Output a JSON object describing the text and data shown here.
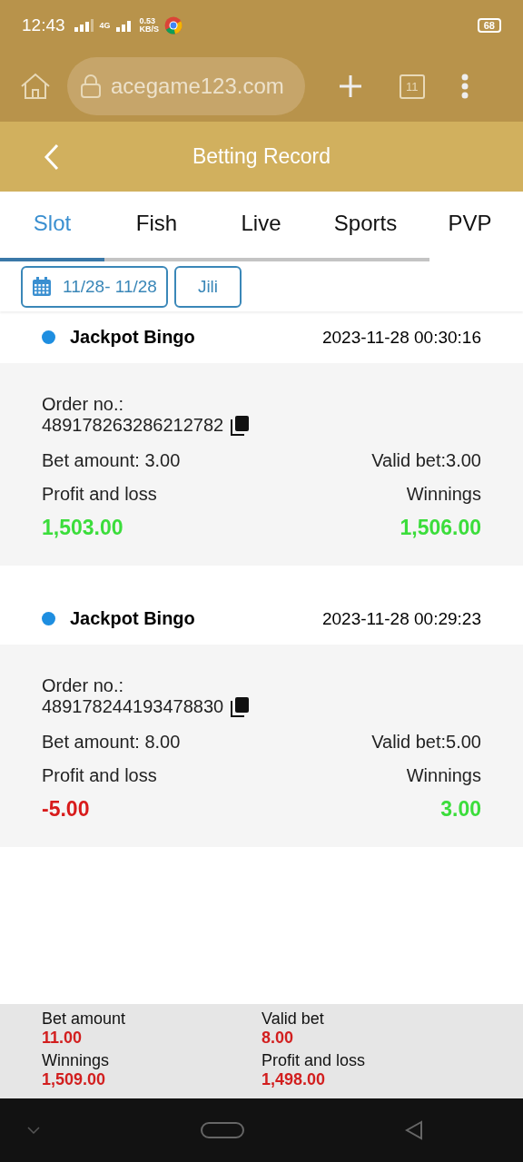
{
  "status_bar": {
    "time": "12:43",
    "network": "4G",
    "speed": "0.53",
    "speed_unit": "KB/S",
    "battery": "68"
  },
  "browser": {
    "url": "acegame123.com",
    "tab_count": "11"
  },
  "header": {
    "title": "Betting Record"
  },
  "tabs": [
    {
      "label": "Slot",
      "selected": true
    },
    {
      "label": "Fish",
      "selected": false
    },
    {
      "label": "Live",
      "selected": false
    },
    {
      "label": "Sports",
      "selected": false
    },
    {
      "label": "PVP",
      "selected": false
    }
  ],
  "filters": {
    "date_range": "11/28- 11/28",
    "provider": "Jili"
  },
  "records": [
    {
      "game": "Jackpot Bingo",
      "time": "2023-11-28 00:30:16",
      "order_label": "Order no.:",
      "order_no": "489178263286212782",
      "bet_amount": "Bet amount: 3.00",
      "valid_bet": "Valid bet:3.00",
      "profit_label": "Profit and loss",
      "profit": {
        "value": "1,503.00",
        "color": "#3bdd3b"
      },
      "winnings_label": "Winnings",
      "winnings": {
        "value": "1,506.00",
        "color": "#3bdd3b"
      }
    },
    {
      "game": "Jackpot Bingo",
      "time": "2023-11-28 00:29:23",
      "order_label": "Order no.:",
      "order_no": "489178244193478830",
      "bet_amount": "Bet amount: 8.00",
      "valid_bet": "Valid bet:5.00",
      "profit_label": "Profit and loss",
      "profit": {
        "value": "-5.00",
        "color": "#d81b1b"
      },
      "winnings_label": "Winnings",
      "winnings": {
        "value": "3.00",
        "color": "#3bdd3b"
      }
    }
  ],
  "summary": [
    {
      "label": "Bet amount",
      "value": "11.00"
    },
    {
      "label": "Valid bet",
      "value": "8.00"
    },
    {
      "label": "Winnings",
      "value": "1,509.00"
    },
    {
      "label": "Profit and loss",
      "value": "1,498.00"
    }
  ]
}
